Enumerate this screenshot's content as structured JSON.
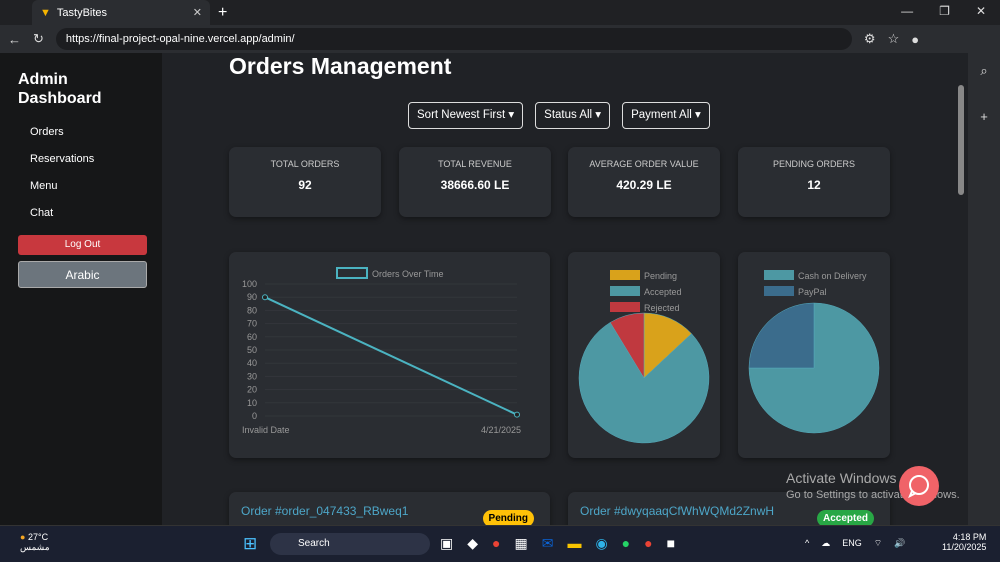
{
  "browser": {
    "tab_title": "TastyBites",
    "url": "https://final-project-opal-nine.vercel.app/admin/"
  },
  "sidebar": {
    "title": "Admin Dashboard",
    "items": [
      "Orders",
      "Reservations",
      "Menu",
      "Chat"
    ],
    "logout": "Log Out",
    "language": "Arabic"
  },
  "main": {
    "title": "Orders Management",
    "filters": [
      "Sort Newest First ▾",
      "Status All ▾",
      "Payment All ▾"
    ],
    "stats": [
      {
        "label": "TOTAL ORDERS",
        "value": "92"
      },
      {
        "label": "TOTAL REVENUE",
        "value": "38666.60 LE"
      },
      {
        "label": "AVERAGE ORDER VALUE",
        "value": "420.29 LE"
      },
      {
        "label": "PENDING ORDERS",
        "value": "12"
      }
    ],
    "orders": [
      {
        "id": "Order #order_047433_RBweq1",
        "status": "Pending"
      },
      {
        "id": "Order #dwyqaaqCfWhWQMd2ZnwH",
        "status": "Accepted"
      }
    ]
  },
  "chart_data": [
    {
      "type": "line",
      "legend": "Orders Over Time",
      "categories": [
        "Invalid Date",
        "4/21/2025"
      ],
      "values": [
        90,
        1
      ],
      "ylim": [
        0,
        100
      ],
      "yticks": [
        "100",
        "90",
        "80",
        "70",
        "60",
        "50",
        "40",
        "30",
        "20",
        "10",
        "0"
      ],
      "color": "#4bb3c1"
    },
    {
      "type": "pie",
      "labels": [
        "Pending",
        "Accepted",
        "Rejected"
      ],
      "values": [
        12,
        72,
        8
      ],
      "colors": [
        "#d9a21b",
        "#4d98a3",
        "#c0393f"
      ]
    },
    {
      "type": "pie",
      "labels": [
        "Cash on Delivery",
        "PayPal"
      ],
      "values": [
        69,
        23
      ],
      "colors": [
        "#4d98a3",
        "#3b6c8c"
      ]
    }
  ],
  "watermark": {
    "line1": "Activate Windows",
    "line2": "Go to Settings to activate Windows."
  },
  "taskbar": {
    "weather": "27°C",
    "weather_desc": "مشمس",
    "search": "Search",
    "lang": "ENG",
    "time": "4:18 PM",
    "date": "11/20/2025"
  }
}
